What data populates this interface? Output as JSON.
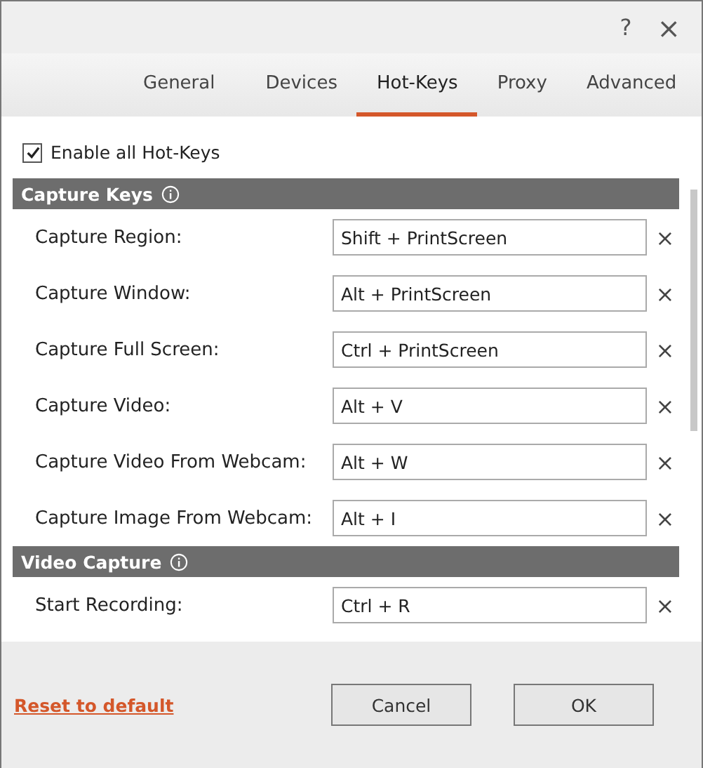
{
  "window": {
    "help": "?",
    "close": "×"
  },
  "tabs": [
    {
      "label": "General",
      "selected": false
    },
    {
      "label": "Devices",
      "selected": false
    },
    {
      "label": "Hot-Keys",
      "selected": true
    },
    {
      "label": "Proxy",
      "selected": false
    },
    {
      "label": "Advanced",
      "selected": false
    }
  ],
  "enable_all": {
    "label": "Enable all Hot-Keys",
    "checked": true
  },
  "sections": [
    {
      "title": "Capture Keys",
      "rows": [
        {
          "label": "Capture Region:",
          "value": "Shift + PrintScreen",
          "clear": "×"
        },
        {
          "label": "Capture Window:",
          "value": "Alt + PrintScreen",
          "clear": "×"
        },
        {
          "label": "Capture Full Screen:",
          "value": "Ctrl + PrintScreen",
          "clear": "×"
        },
        {
          "label": "Capture Video:",
          "value": "Alt + V",
          "clear": "×"
        },
        {
          "label": "Capture Video From Webcam:",
          "value": "Alt + W",
          "clear": "×"
        },
        {
          "label": "Capture Image From Webcam:",
          "value": "Alt + I",
          "clear": "×"
        }
      ]
    },
    {
      "title": "Video Capture",
      "rows": [
        {
          "label": "Start Recording:",
          "value": "Ctrl + R",
          "clear": "×"
        }
      ]
    }
  ],
  "footer": {
    "reset": "Reset to default",
    "buttons": [
      "Cancel",
      "OK"
    ]
  }
}
